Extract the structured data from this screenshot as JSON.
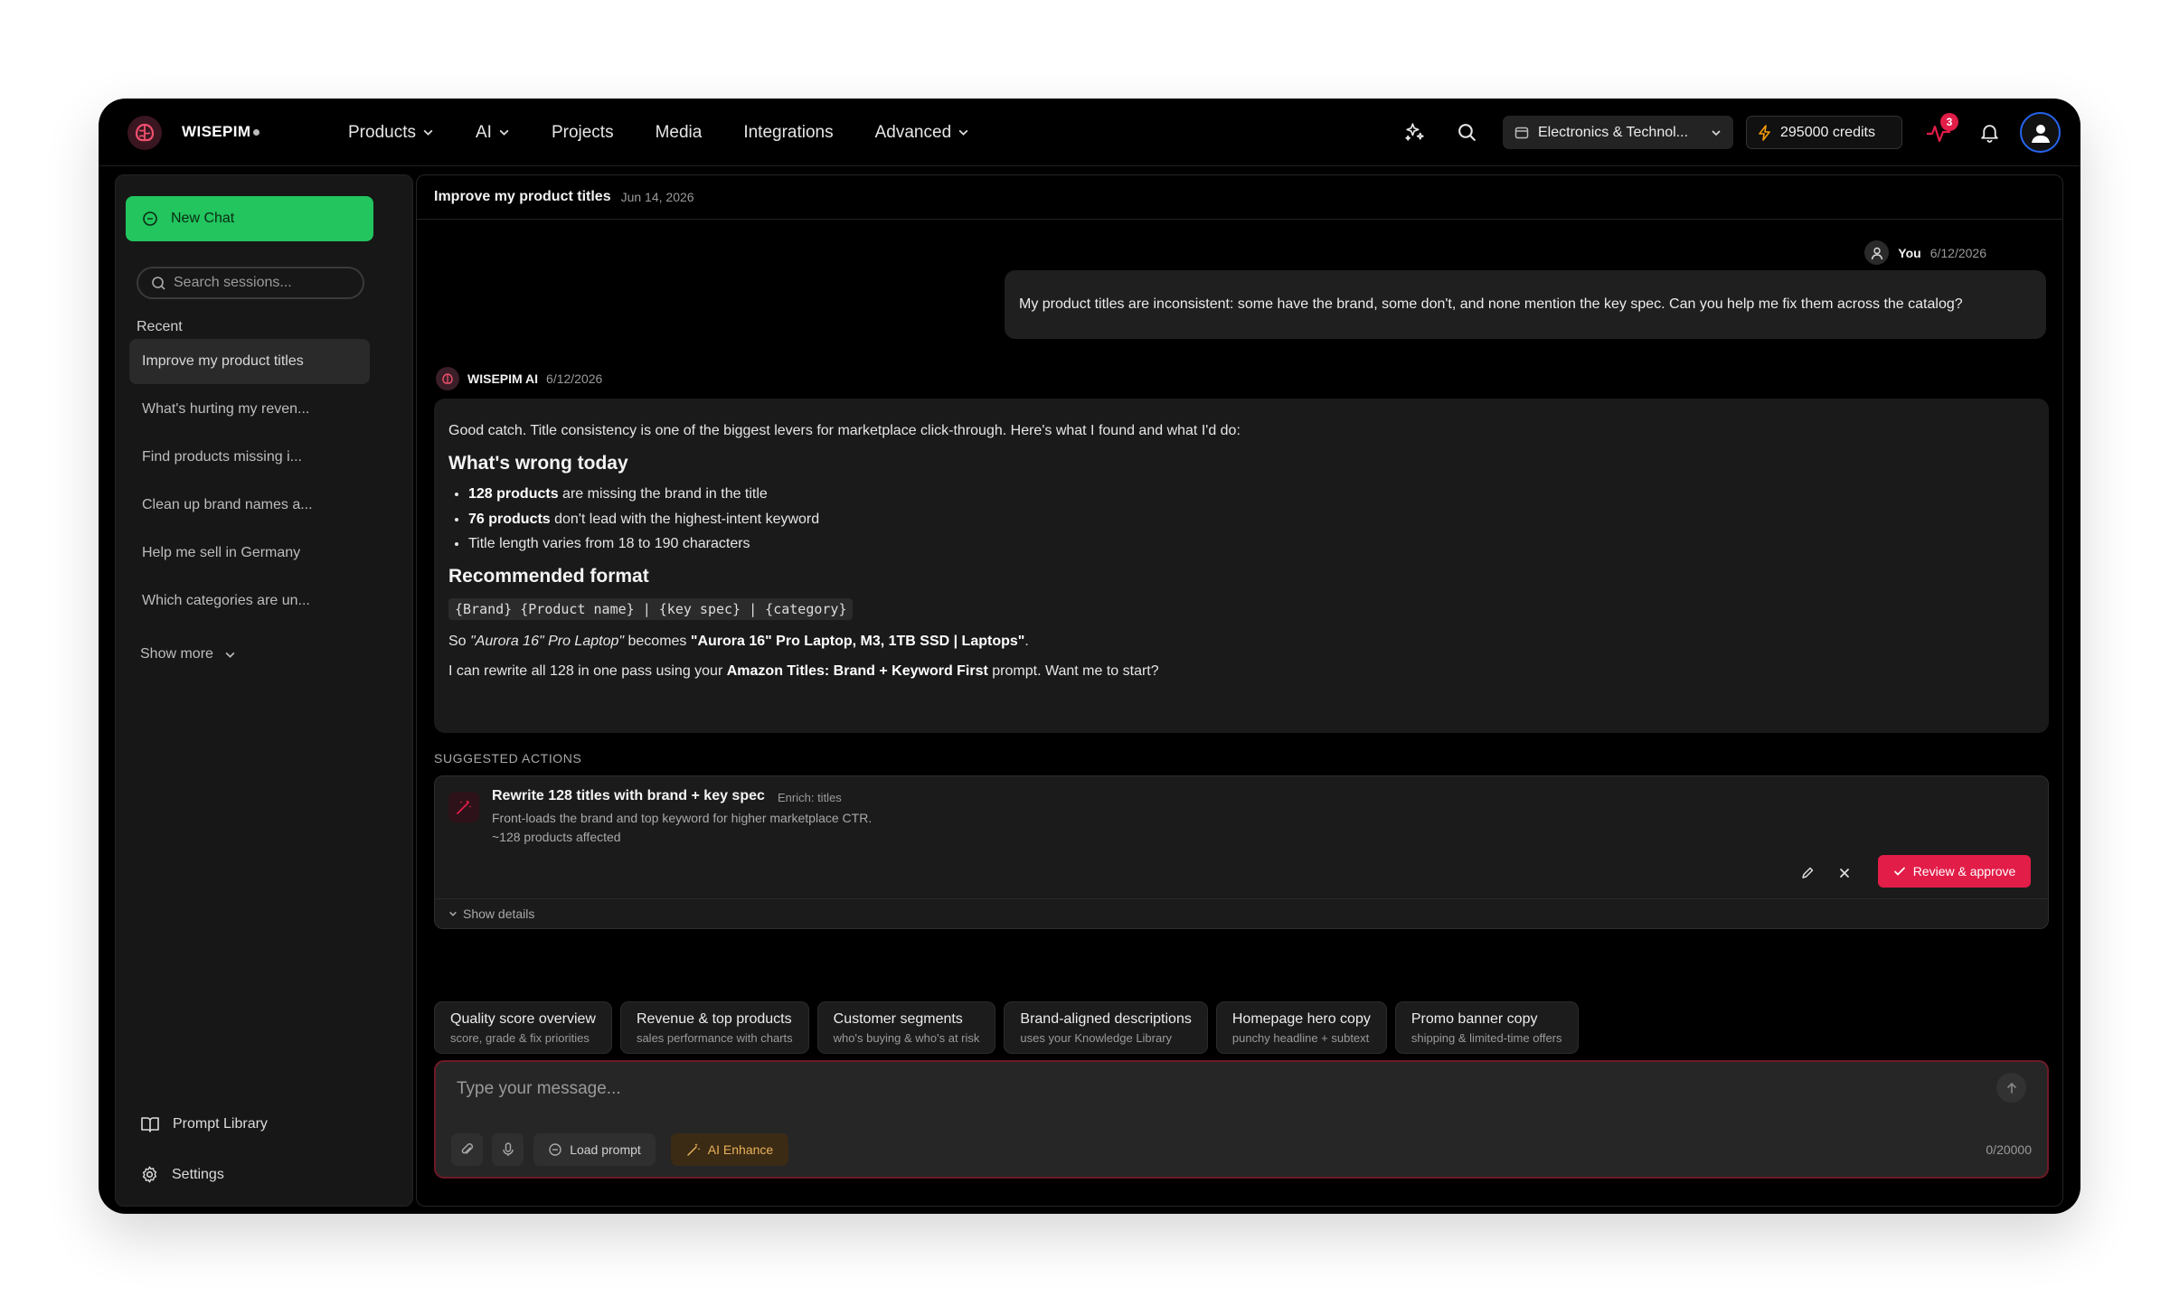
{
  "nav": {
    "brand": "WISEPIM",
    "items": [
      {
        "label": "Products",
        "dropdown": true
      },
      {
        "label": "AI",
        "dropdown": true
      },
      {
        "label": "Projects",
        "dropdown": false
      },
      {
        "label": "Media",
        "dropdown": false
      },
      {
        "label": "Integrations",
        "dropdown": false
      },
      {
        "label": "Advanced",
        "dropdown": true
      }
    ],
    "store": "Electronics & Technol...",
    "credits": "295000 credits",
    "alert_count": "3"
  },
  "sidebar": {
    "new_chat": "New Chat",
    "search_placeholder": "Search sessions...",
    "recent_label": "Recent",
    "sessions": [
      "Improve my product titles",
      "What's hurting my reven...",
      "Find products missing i...",
      "Clean up brand names a...",
      "Help me sell in Germany",
      "Which categories are un..."
    ],
    "show_more": "Show more",
    "prompt_library": "Prompt Library",
    "settings": "Settings"
  },
  "chat": {
    "title": "Improve my product titles",
    "date": "Jun 14, 2026",
    "user_name": "You",
    "user_date": "6/12/2026",
    "user_message": "My product titles are inconsistent: some have the brand, some don't, and none mention the key spec. Can you help me fix them across the catalog?",
    "ai_name": "WISEPIM AI",
    "ai_date": "6/12/2026",
    "ai": {
      "intro": "Good catch. Title consistency is one of the biggest levers for marketplace click-through. Here's what I found and what I'd do:",
      "h1": "What's wrong today",
      "bullets": [
        {
          "bold": "128 products",
          "rest": " are missing the brand in the title"
        },
        {
          "bold": "76 products",
          "rest": " don't lead with the highest-intent keyword"
        },
        {
          "bold": "",
          "rest": "Title length varies from 18 to 190 characters"
        }
      ],
      "h2": "Recommended format",
      "format_code": "{Brand} {Product name} | {key spec} | {category}",
      "example_prefix": "So ",
      "example_before": "\"Aurora 16\" Pro Laptop\"",
      "example_mid": " becomes ",
      "example_after": "\"Aurora 16\" Pro Laptop, M3, 1TB SSD | Laptops\"",
      "example_end": ".",
      "closing_prefix": "I can rewrite all 128 in one pass using your ",
      "closing_bold": "Amazon Titles: Brand + Keyword First",
      "closing_suffix": " prompt. Want me to start?"
    }
  },
  "suggested": {
    "label": "SUGGESTED ACTIONS",
    "title": "Rewrite 128 titles with brand + key spec",
    "tag": "Enrich: titles",
    "desc": "Front-loads the brand and top keyword for higher marketplace CTR.",
    "count": "~128 products affected",
    "review": "Review & approve",
    "show_details": "Show details"
  },
  "chips": [
    {
      "title": "Quality score overview",
      "sub": "score, grade & fix priorities"
    },
    {
      "title": "Revenue & top products",
      "sub": "sales performance with charts"
    },
    {
      "title": "Customer segments",
      "sub": "who's buying & who's at risk"
    },
    {
      "title": "Brand-aligned descriptions",
      "sub": "uses your Knowledge Library"
    },
    {
      "title": "Homepage hero copy",
      "sub": "punchy headline + subtext"
    },
    {
      "title": "Promo banner copy",
      "sub": "shipping & limited-time offers"
    }
  ],
  "composer": {
    "placeholder": "Type your message...",
    "load_prompt": "Load prompt",
    "ai_enhance": "AI Enhance",
    "char_count": "0/20000"
  },
  "colors": {
    "accent_green": "#22c55e",
    "accent_red": "#e11d48",
    "enhance_amber": "#eab25a"
  }
}
